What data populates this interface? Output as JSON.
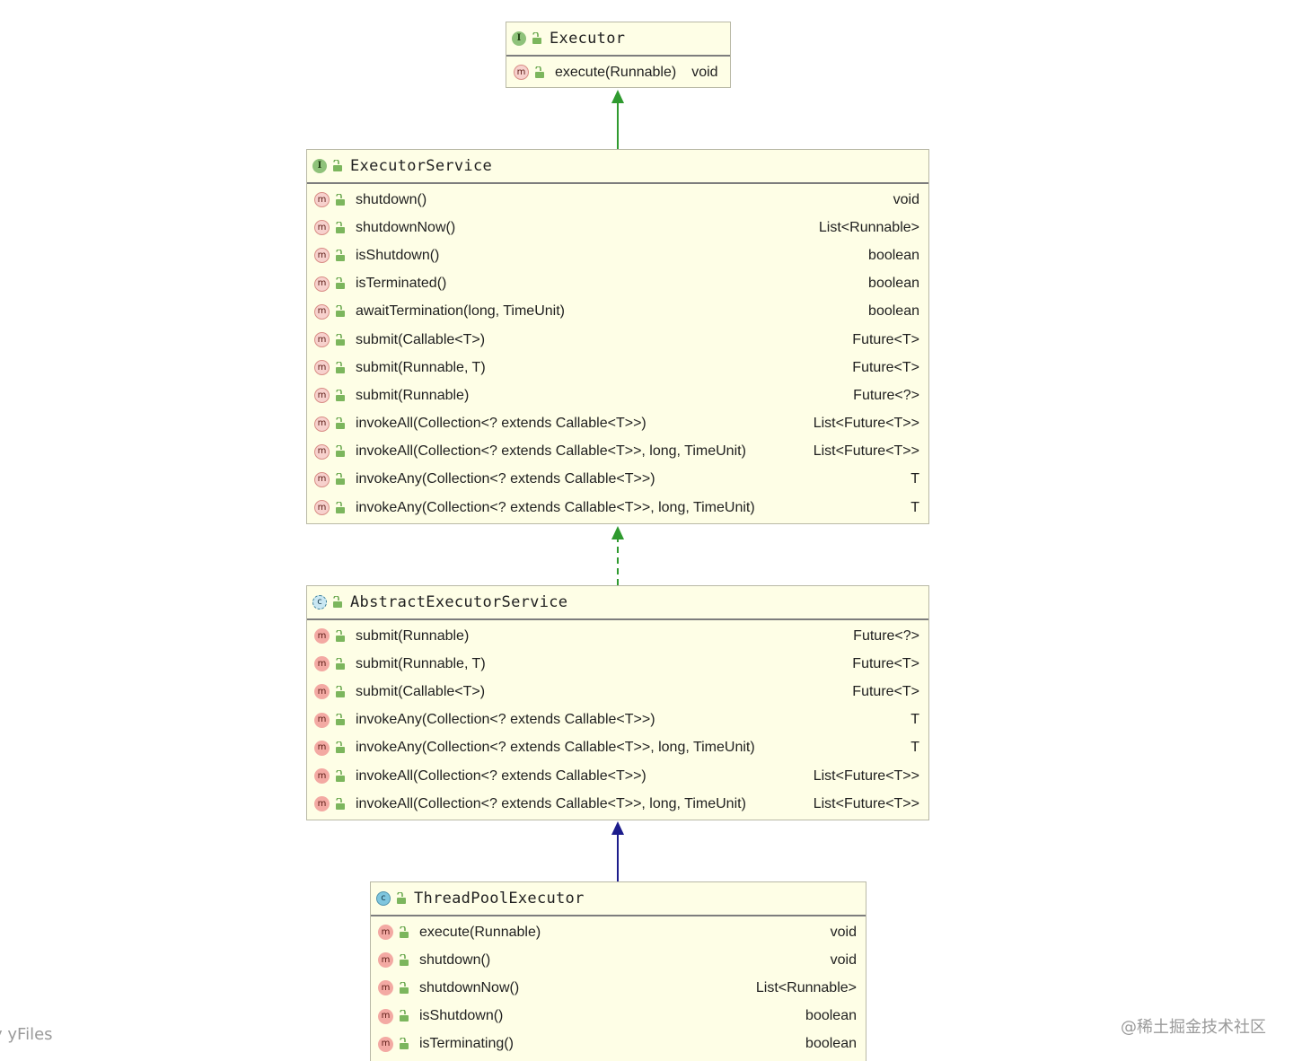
{
  "diagram": {
    "nodes": [
      {
        "id": "executor",
        "kind": "interface",
        "badge": "I",
        "title": "Executor",
        "methods": [
          {
            "badge": "m",
            "name": "execute(Runnable)",
            "type": "void"
          }
        ]
      },
      {
        "id": "executor-service",
        "kind": "interface",
        "badge": "I",
        "title": "ExecutorService",
        "methods": [
          {
            "badge": "m",
            "name": "shutdown()",
            "type": "void"
          },
          {
            "badge": "m",
            "name": "shutdownNow()",
            "type": "List<Runnable>"
          },
          {
            "badge": "m",
            "name": "isShutdown()",
            "type": "boolean"
          },
          {
            "badge": "m",
            "name": "isTerminated()",
            "type": "boolean"
          },
          {
            "badge": "m",
            "name": "awaitTermination(long, TimeUnit)",
            "type": "boolean"
          },
          {
            "badge": "m",
            "name": "submit(Callable<T>)",
            "type": "Future<T>"
          },
          {
            "badge": "m",
            "name": "submit(Runnable, T)",
            "type": "Future<T>"
          },
          {
            "badge": "m",
            "name": "submit(Runnable)",
            "type": "Future<?>"
          },
          {
            "badge": "m",
            "name": "invokeAll(Collection<? extends Callable<T>>)",
            "type": "List<Future<T>>"
          },
          {
            "badge": "m",
            "name": "invokeAll(Collection<? extends Callable<T>>, long, TimeUnit)",
            "type": "List<Future<T>>"
          },
          {
            "badge": "m",
            "name": "invokeAny(Collection<? extends Callable<T>>)",
            "type": "T"
          },
          {
            "badge": "m",
            "name": "invokeAny(Collection<? extends Callable<T>>, long, TimeUnit)",
            "type": "T"
          }
        ]
      },
      {
        "id": "abstract-executor-service",
        "kind": "abstract",
        "badge": "c",
        "title": "AbstractExecutorService",
        "methods": [
          {
            "badge": "m",
            "name": "submit(Runnable)",
            "type": "Future<?>"
          },
          {
            "badge": "m",
            "name": "submit(Runnable, T)",
            "type": "Future<T>"
          },
          {
            "badge": "m",
            "name": "submit(Callable<T>)",
            "type": "Future<T>"
          },
          {
            "badge": "m",
            "name": "invokeAny(Collection<? extends Callable<T>>)",
            "type": "T"
          },
          {
            "badge": "m",
            "name": "invokeAny(Collection<? extends Callable<T>>, long, TimeUnit)",
            "type": "T"
          },
          {
            "badge": "m",
            "name": "invokeAll(Collection<? extends Callable<T>>)",
            "type": "List<Future<T>>"
          },
          {
            "badge": "m",
            "name": "invokeAll(Collection<? extends Callable<T>>, long, TimeUnit)",
            "type": "List<Future<T>>"
          }
        ]
      },
      {
        "id": "thread-pool-executor",
        "kind": "class",
        "badge": "c",
        "title": "ThreadPoolExecutor",
        "methods": [
          {
            "badge": "m",
            "name": "execute(Runnable)",
            "type": "void"
          },
          {
            "badge": "m",
            "name": "shutdown()",
            "type": "void"
          },
          {
            "badge": "m",
            "name": "shutdownNow()",
            "type": "List<Runnable>"
          },
          {
            "badge": "m",
            "name": "isShutdown()",
            "type": "boolean"
          },
          {
            "badge": "m",
            "name": "isTerminating()",
            "type": "boolean"
          }
        ]
      }
    ],
    "edges": [
      {
        "from": "executor-service",
        "to": "executor",
        "style": "solid",
        "color": "#2f9a2f"
      },
      {
        "from": "abstract-executor-service",
        "to": "executor-service",
        "style": "dashed",
        "color": "#2f9a2f"
      },
      {
        "from": "thread-pool-executor",
        "to": "abstract-executor-service",
        "style": "solid",
        "color": "#1c1c8c"
      }
    ]
  },
  "watermarks": {
    "left": "y yFiles",
    "right": "@稀土掘金技术社区"
  },
  "colors": {
    "box_fill": "#fefee6",
    "interface_badge": "#8fc27a",
    "class_badge": "#7fc6de",
    "method_badge": "#f3a9a3"
  }
}
